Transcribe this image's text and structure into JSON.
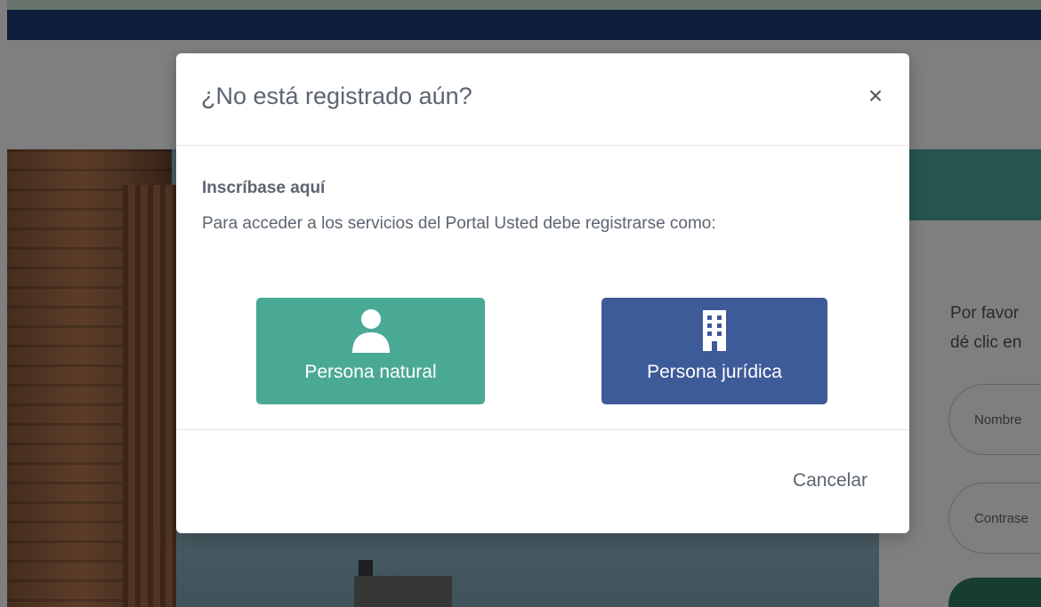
{
  "background": {
    "login_prompt_line1": "Por favor",
    "login_prompt_line2": "dé clic en",
    "username_placeholder": "Nombre",
    "password_placeholder": "Contrase"
  },
  "modal": {
    "title": "¿No está registrado aún?",
    "close_label": "×",
    "subtitle": "Inscríbase aquí",
    "description": "Para acceder a los servicios del Portal Usted debe registrarse como:",
    "options": [
      {
        "label": "Persona natural",
        "icon": "user-icon",
        "color": "#4aa994"
      },
      {
        "label": "Persona jurídica",
        "icon": "building-icon",
        "color": "#3d5a99"
      }
    ],
    "cancel_label": "Cancelar"
  }
}
